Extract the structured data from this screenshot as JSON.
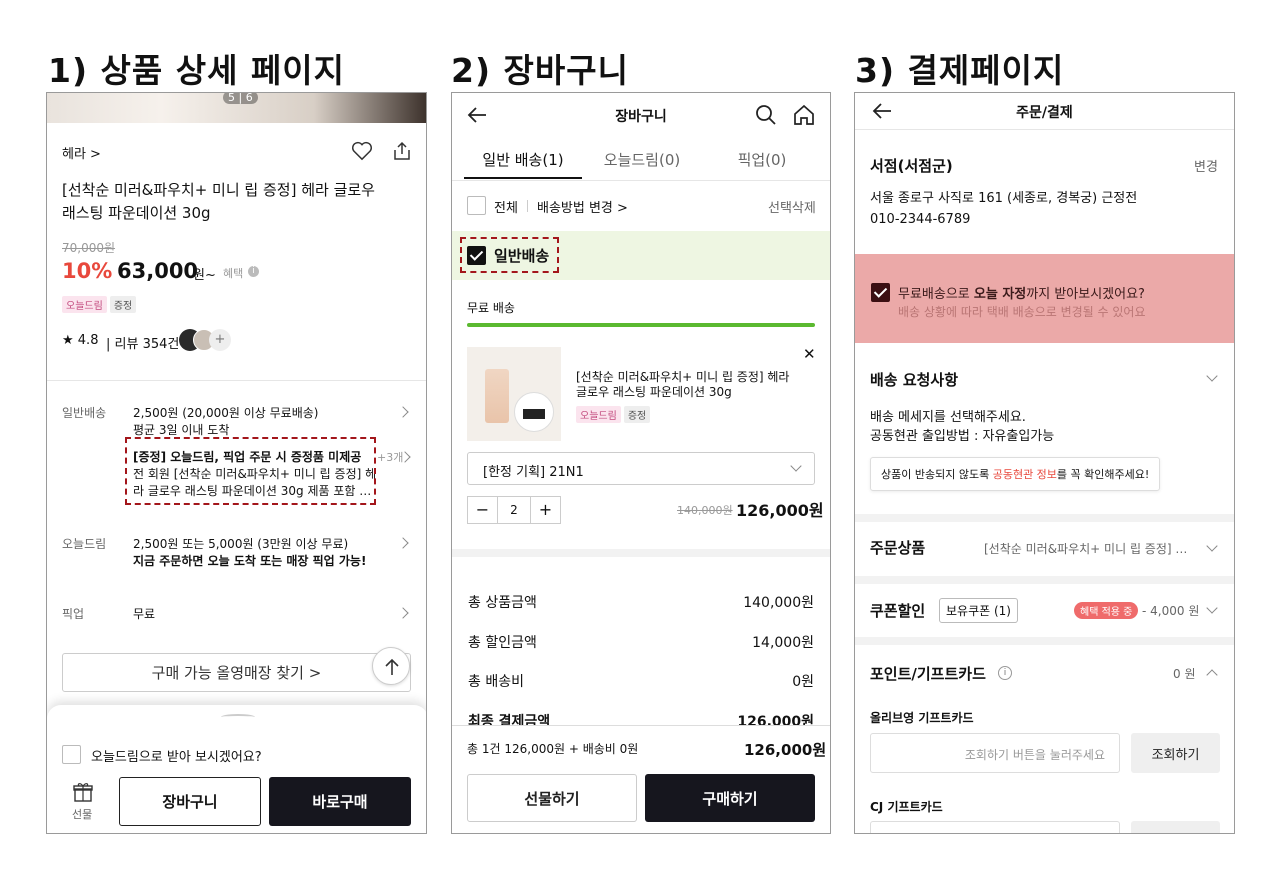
{
  "headings": [
    "1) 상품 상세 페이지",
    "2) 장바구니",
    "3) 결제페이지"
  ],
  "p1": {
    "img_counter": "5 | 6",
    "brand": "헤라 >",
    "product_title_1": "[선착순 미러&파우치+ 미니 립 증정] 헤라 글로우",
    "product_title_2": "래스팅 파운데이션 30g",
    "orig_price": "70,000원",
    "discount": "10%",
    "price": "63,000",
    "price_unit": "원~",
    "benefit": "혜택",
    "tags": [
      "오늘드림",
      "증정"
    ],
    "rating": "★ 4.8",
    "reviews": "| 리뷰 354건",
    "ship_label": "일반배송",
    "ship_line1": "2,500원 (20,000원 이상 무료배송)",
    "ship_line2": "평균 3일 이내 도착",
    "gift_line1": "[증정] 오늘드림, 픽업 주문 시 증정품 미제공",
    "gift_line2": "전 회원 [선착순 미러&파우치+ 미니 립 증정] 헤",
    "gift_line3": "라 글로우 래스팅 파운데이션 30g 제품 포함 …",
    "gift_more": "+3개",
    "today_label": "오늘드림",
    "today_line1": "2,500원 또는 5,000원 (3만원 이상 무료)",
    "today_line2": "지금 주문하면 오늘 도착 또는 매장 픽업 가능!",
    "pickup_label": "픽업",
    "pickup_value": "무료",
    "store_find": "구매 가능 올영매장 찾기 >",
    "sheet_question": "오늘드림으로 받아 보시겠어요?",
    "gift_icon_label": "선물",
    "cart_btn": "장바구니",
    "buy_btn": "바로구매"
  },
  "p2": {
    "title": "장바구니",
    "tabs": [
      "일반 배송(1)",
      "오늘드림(0)",
      "픽업(0)"
    ],
    "all": "전체",
    "ship_change": "배송방법 변경 >",
    "delete_sel": "선택삭제",
    "group": "일반배송",
    "free_ship": "무료 배송",
    "item_title_1": "[선착순 미러&파우치+ 미니 립 증정] 헤라",
    "item_title_2": "글로우 래스팅 파운데이션 30g",
    "item_tags": [
      "오늘드림",
      "증정"
    ],
    "option": "[한정 기획] 21N1",
    "qty": "2",
    "orig_price": "140,000원",
    "price": "126,000원",
    "sum_rows": [
      {
        "label": "총 상품금액",
        "value": "140,000원"
      },
      {
        "label": "총 할인금액",
        "value": "14,000원"
      },
      {
        "label": "총 배송비",
        "value": "0원"
      },
      {
        "label": "최종 결제금액",
        "value": "126,000원"
      }
    ],
    "footer_left": "총 1건 126,000원 + 배송비 0원",
    "footer_right": "126,000원",
    "gift_btn": "선물하기",
    "buy_btn": "구매하기"
  },
  "p3": {
    "title": "주문/결제",
    "addr_name": "서점(서점군)",
    "change": "변경",
    "addr": "서울 종로구 사직로 161 (세종로, 경복궁) 근정전",
    "phone": "010-2344-6789",
    "today_q_pre": "무료배송으로 ",
    "today_q_bold": "오늘 자정",
    "today_q_post": "까지 받아보시겠어요?",
    "today_sub": "배송 상황에 따라 택배 배송으로 변경될 수 있어요",
    "req_title": "배송 요청사항",
    "req_line1": "배송 메세지를 선택해주세요.",
    "req_line2": "공동현관 출입방법 : 자유출입가능",
    "notice_pre": "상품이 반송되지 않도록 ",
    "notice_red": "공동현관 정보",
    "notice_post": "를 꼭 확인해주세요!",
    "order_label": "주문상품",
    "order_value": "[선착순 미러&파우치+ 미니 립 증정] …",
    "coupon_label": "쿠폰할인",
    "coupon_chip": "보유쿠폰 (1)",
    "coupon_badge": "혜택 적용 중",
    "coupon_value": "- 4,000 원",
    "point_label": "포인트/기프트카드",
    "point_value": "0 원",
    "giftcard_label": "올리브영 기프트카드",
    "giftcard_placeholder": "조회하기 버튼을 눌러주세요",
    "lookup_btn": "조회하기",
    "cj_label": "CJ 기프트카드"
  },
  "colors": {
    "accent_red": "#e8483c",
    "check_green": "#eef6e2",
    "progress": "#5bb930",
    "alert_bg": "#eba9a8",
    "dash_red": "#a3161b",
    "dark_btn": "#16161e"
  }
}
